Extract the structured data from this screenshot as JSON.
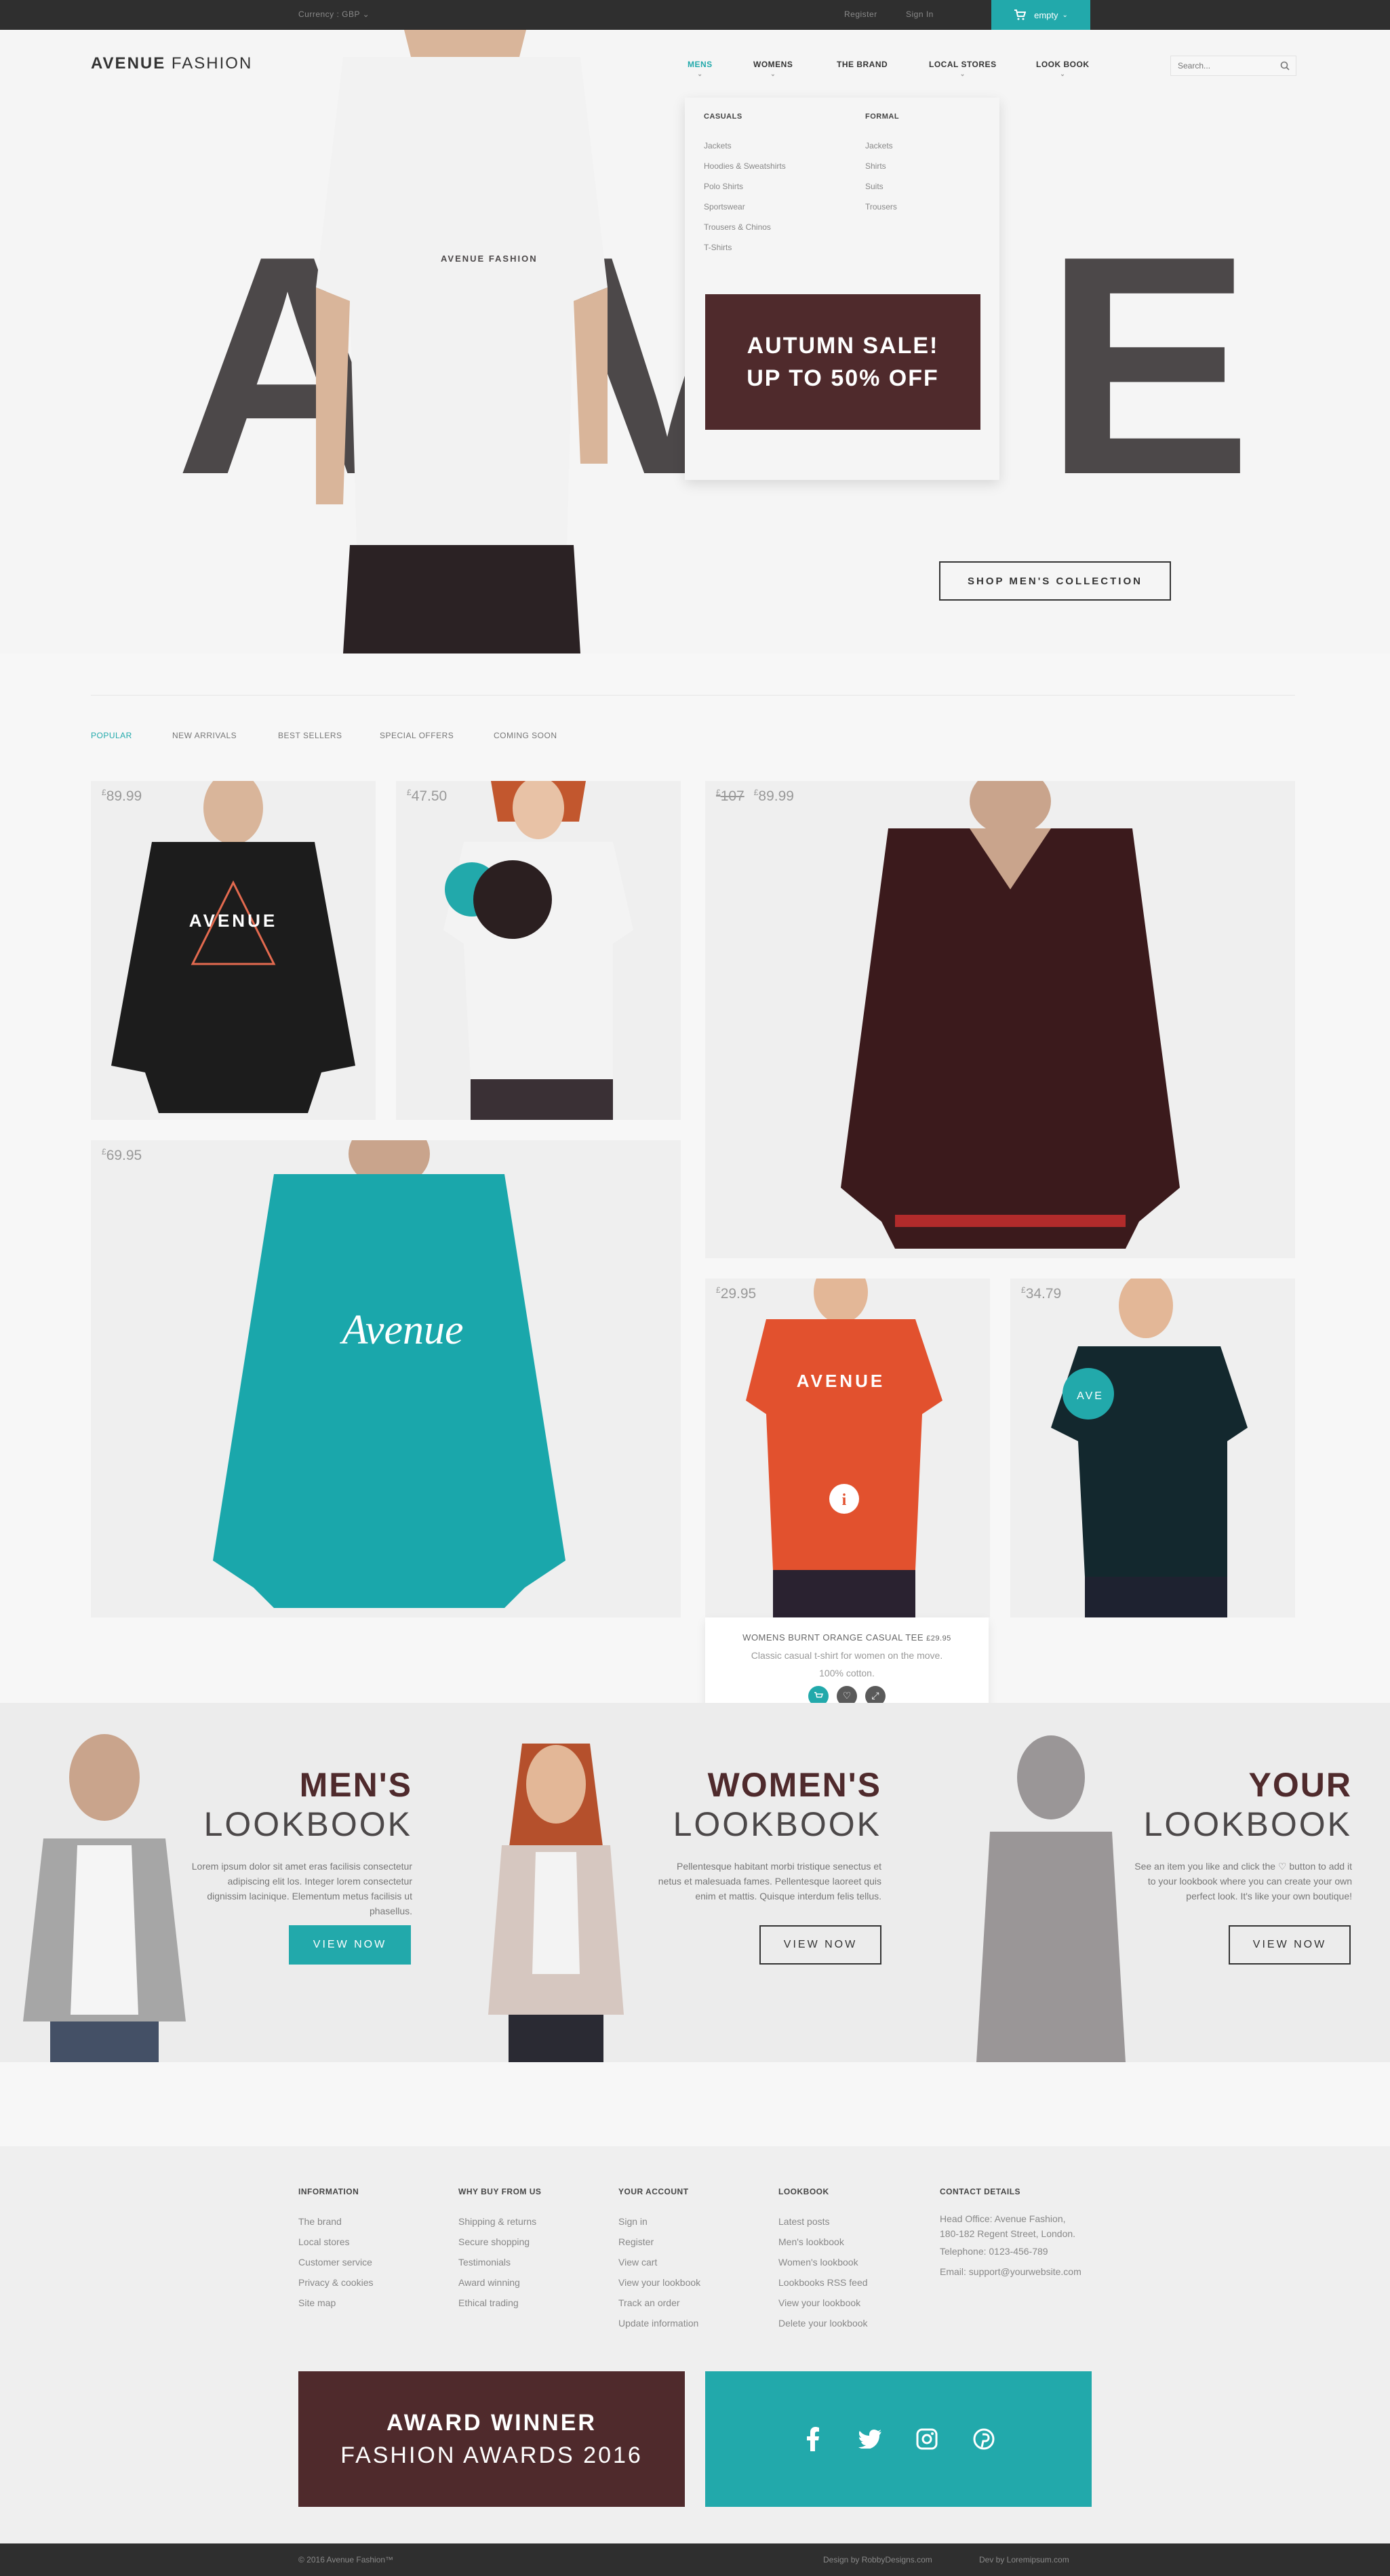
{
  "topbar": {
    "currency": "Currency : GBP",
    "register": "Register",
    "sign_in": "Sign In",
    "cart_label": "empty"
  },
  "header": {
    "logo_bold": "AVENUE",
    "logo_light": "FASHION",
    "nav": [
      "MENS",
      "WOMENS",
      "THE BRAND",
      "LOCAL STORES",
      "LOOK BOOK"
    ],
    "search_placeholder": "Search..."
  },
  "hero": {
    "big_letters": [
      "A",
      "V",
      "E"
    ],
    "model_print": "AVENUE FASHION",
    "mega_menu": {
      "casuals": {
        "heading": "CASUALS",
        "items": [
          "Jackets",
          "Hoodies & Sweatshirts",
          "Polo Shirts",
          "Sportswear",
          "Trousers & Chinos",
          "T-Shirts"
        ]
      },
      "formal": {
        "heading": "FORMAL",
        "items": [
          "Jackets",
          "Shirts",
          "Suits",
          "Trousers"
        ]
      }
    },
    "sale_line1": "AUTUMN SALE!",
    "sale_line2": "UP TO 50% OFF",
    "shop_button": "SHOP MEN'S COLLECTION"
  },
  "products": {
    "tabs": [
      "POPULAR",
      "NEW ARRIVALS",
      "BEST SELLERS",
      "SPECIAL OFFERS",
      "COMING SOON"
    ],
    "items": [
      {
        "currency": "£",
        "price": "89.99",
        "shirt_text": "AVENUE"
      },
      {
        "currency": "£",
        "price": "47.50"
      },
      {
        "currency": "£",
        "old_price": "107",
        "price": "89.99"
      },
      {
        "currency": "£",
        "price": "69.95",
        "shirt_text": "Avenue"
      },
      {
        "currency": "£",
        "price": "29.95",
        "shirt_text": "AVENUE"
      },
      {
        "currency": "£",
        "price": "34.79",
        "badge_text": "AVE"
      }
    ],
    "detail": {
      "name": "WOMENS BURNT ORANGE CASUAL TEE",
      "price": "£29.95",
      "description": "Classic casual t-shirt for women on the move. 100% cotton."
    }
  },
  "lookbooks": [
    {
      "title1": "MEN'S",
      "title2": "LOOKBOOK",
      "text": "Lorem ipsum dolor sit amet eras facilisis consectetur adipiscing elit los. Integer lorem consectetur dignissim lacinique. Elementum metus facilisis ut phasellus.",
      "button": "VIEW NOW"
    },
    {
      "title1": "WOMEN'S",
      "title2": "LOOKBOOK",
      "text": "Pellentesque habitant morbi tristique senectus et netus et malesuada fames. Pellentesque laoreet quis enim et mattis. Quisque interdum felis tellus.",
      "button": "VIEW NOW"
    },
    {
      "title1": "YOUR",
      "title2": "LOOKBOOK",
      "text": "See an item you like and click the ♡ button to add it to your lookbook where you can create your own perfect look. It's like your own boutique!",
      "button": "VIEW NOW"
    }
  ],
  "footer": {
    "columns": [
      {
        "heading": "INFORMATION",
        "links": [
          "The brand",
          "Local stores",
          "Customer service",
          "Privacy & cookies",
          "Site map"
        ]
      },
      {
        "heading": "WHY BUY FROM US",
        "links": [
          "Shipping & returns",
          "Secure shopping",
          "Testimonials",
          "Award winning",
          "Ethical trading"
        ]
      },
      {
        "heading": "YOUR ACCOUNT",
        "links": [
          "Sign in",
          "Register",
          "View cart",
          "View your lookbook",
          "Track an order",
          "Update information"
        ]
      },
      {
        "heading": "LOOKBOOK",
        "links": [
          "Latest posts",
          "Men's lookbook",
          "Women's lookbook",
          "Lookbooks RSS feed",
          "View your lookbook",
          "Delete your lookbook"
        ]
      },
      {
        "heading": "CONTACT DETAILS",
        "links": [
          "Head Office: Avenue Fashion,",
          "180-182 Regent Street, London.",
          "",
          "Telephone: 0123-456-789",
          "Email: support@yourwebsite.com"
        ]
      }
    ],
    "award_line1": "AWARD WINNER",
    "award_line2": "FASHION AWARDS 2016",
    "social_icons": [
      "facebook-icon",
      "twitter-icon",
      "instagram-icon",
      "pinterest-icon"
    ]
  },
  "bottombar": {
    "copyright": "© 2016 Avenue Fashion™",
    "design": "Design by RobbyDesigns.com",
    "dev": "Dev by Loremipsum.com"
  },
  "colors": {
    "accent": "#22a9ab",
    "burgundy": "#4f2a2c",
    "dark": "#2f2f2f",
    "big_letters": "#4c4849"
  }
}
